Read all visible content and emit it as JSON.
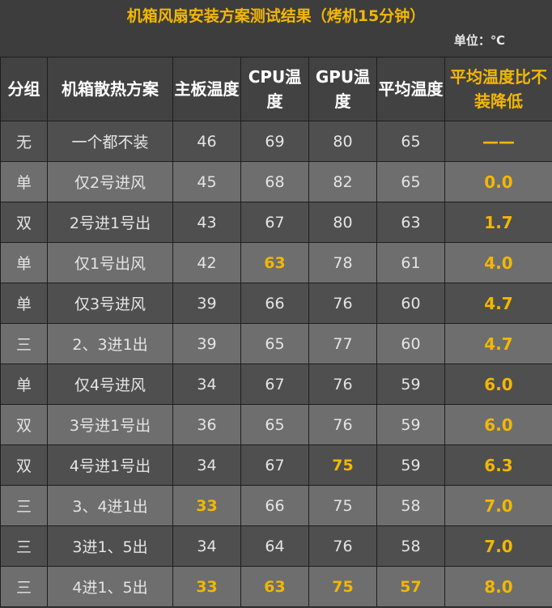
{
  "title": "机箱风扇安装方案测试结果（烤机15分钟）",
  "unit": "单位：℃",
  "headers": [
    "分组",
    "机箱散热方案",
    "主板温度",
    "CPU温度",
    "GPU温度",
    "平均温度",
    "平均温度比不装降低"
  ],
  "colors": {
    "accent": "#f2b705",
    "row_dark": "#4f4f4f",
    "row_light": "#6e6e6e",
    "background": "#3d3d3d"
  },
  "rows": [
    {
      "group": "无",
      "scheme": "一个都不装",
      "mb": "46",
      "cpu": "69",
      "gpu": "80",
      "avg": "65",
      "drop": "——",
      "highlight": []
    },
    {
      "group": "单",
      "scheme": "仅2号进风",
      "mb": "45",
      "cpu": "68",
      "gpu": "82",
      "avg": "65",
      "drop": "0.0",
      "highlight": []
    },
    {
      "group": "双",
      "scheme": "2号进1号出",
      "mb": "43",
      "cpu": "67",
      "gpu": "80",
      "avg": "63",
      "drop": "1.7",
      "highlight": []
    },
    {
      "group": "单",
      "scheme": "仅1号出风",
      "mb": "42",
      "cpu": "63",
      "gpu": "78",
      "avg": "61",
      "drop": "4.0",
      "highlight": [
        "cpu"
      ]
    },
    {
      "group": "单",
      "scheme": "仅3号进风",
      "mb": "39",
      "cpu": "66",
      "gpu": "76",
      "avg": "60",
      "drop": "4.7",
      "highlight": []
    },
    {
      "group": "三",
      "scheme": "2、3进1出",
      "mb": "39",
      "cpu": "65",
      "gpu": "77",
      "avg": "60",
      "drop": "4.7",
      "highlight": []
    },
    {
      "group": "单",
      "scheme": "仅4号进风",
      "mb": "34",
      "cpu": "67",
      "gpu": "76",
      "avg": "59",
      "drop": "6.0",
      "highlight": []
    },
    {
      "group": "双",
      "scheme": "3号进1号出",
      "mb": "36",
      "cpu": "65",
      "gpu": "76",
      "avg": "59",
      "drop": "6.0",
      "highlight": []
    },
    {
      "group": "双",
      "scheme": "4号进1号出",
      "mb": "34",
      "cpu": "67",
      "gpu": "75",
      "avg": "59",
      "drop": "6.3",
      "highlight": [
        "gpu"
      ]
    },
    {
      "group": "三",
      "scheme": "3、4进1出",
      "mb": "33",
      "cpu": "66",
      "gpu": "75",
      "avg": "58",
      "drop": "7.0",
      "highlight": [
        "mb"
      ]
    },
    {
      "group": "三",
      "scheme": "3进1、5出",
      "mb": "34",
      "cpu": "64",
      "gpu": "76",
      "avg": "58",
      "drop": "7.0",
      "highlight": []
    },
    {
      "group": "三",
      "scheme": "4进1、5出",
      "mb": "33",
      "cpu": "63",
      "gpu": "75",
      "avg": "57",
      "drop": "8.0",
      "highlight": [
        "mb",
        "cpu",
        "gpu",
        "avg"
      ]
    }
  ]
}
